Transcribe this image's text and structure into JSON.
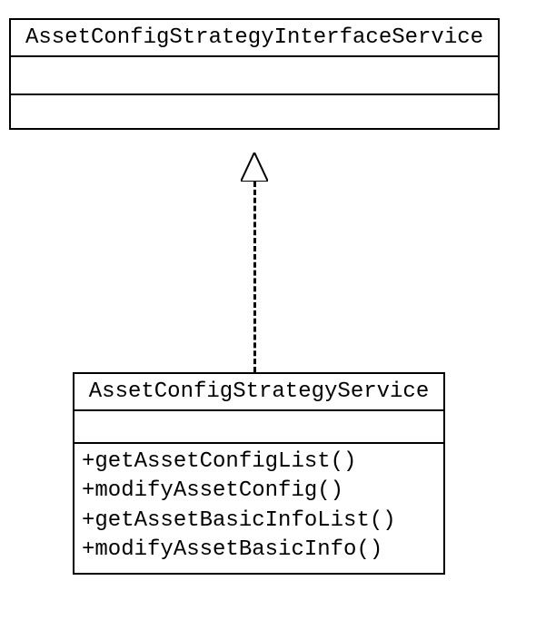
{
  "chart_data": {
    "type": "uml_class_diagram",
    "classes": [
      {
        "id": "interface",
        "name": "AssetConfigStrategyInterfaceService",
        "attributes": [],
        "operations": []
      },
      {
        "id": "service",
        "name": "AssetConfigStrategyService",
        "attributes": [],
        "operations": [
          "+getAssetConfigList()",
          "+modifyAssetConfig()",
          "+getAssetBasicInfoList()",
          "+modifyAssetBasicInfo()"
        ]
      }
    ],
    "relationships": [
      {
        "from": "service",
        "to": "interface",
        "type": "realization",
        "line": "dashed",
        "arrowhead": "hollow-triangle"
      }
    ]
  }
}
